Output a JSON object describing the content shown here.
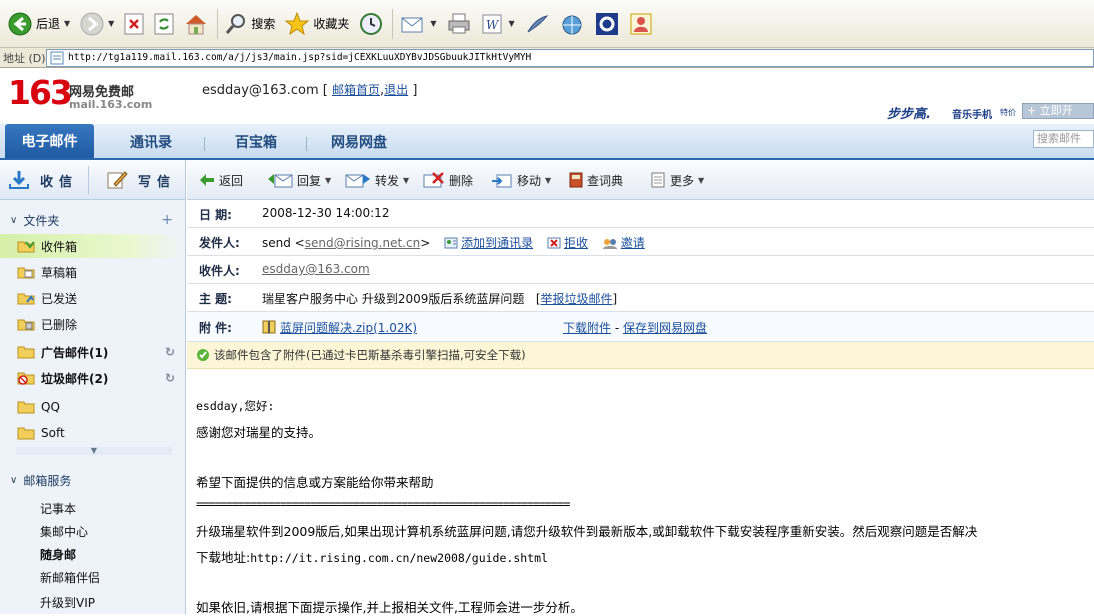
{
  "browser": {
    "toolbar": {
      "back_label": "后退",
      "search_label": "搜索",
      "favorites_label": "收藏夹"
    },
    "address": {
      "label": "地址 (D)",
      "url": "http://tg1a119.mail.163.com/a/j/js3/main.jsp?sid=jCEXKLuuXDYBvJDSGbuukJITkHtVyMYH"
    }
  },
  "header": {
    "logo_number": "163",
    "logo_title": "网易免费邮",
    "logo_domain": "mail.163.com",
    "user_email": "esdday@163.com",
    "bracket_open": "[",
    "home_link": "邮箱首页",
    "comma": ",",
    "logout_link": "退出",
    "bracket_close": "]",
    "ad_brand": "步步高.",
    "ad_sub": "音乐手机",
    "ad_sub2": "特价",
    "ad_open": "+ 立即开",
    "search_placeholder": "搜索邮件"
  },
  "nav": {
    "tabs": [
      "电子邮件",
      "通讯录",
      "百宝箱",
      "网易网盘"
    ]
  },
  "sidebar": {
    "receive_label": "收信",
    "write_label": "写信",
    "folders_head": "文件夹",
    "folders": [
      {
        "label": "收件箱"
      },
      {
        "label": "草稿箱"
      },
      {
        "label": "已发送"
      },
      {
        "label": "已删除"
      },
      {
        "label": "广告邮件(1)"
      },
      {
        "label": "垃圾邮件(2)"
      },
      {
        "label": "QQ"
      },
      {
        "label": "Soft"
      }
    ],
    "services_head": "邮箱服务",
    "services": [
      "记事本",
      "集邮中心",
      "随身邮",
      "新邮箱伴侣",
      "升级到VIP"
    ]
  },
  "mail_toolbar": {
    "back": "返回",
    "reply": "回复",
    "forward": "转发",
    "delete": "删除",
    "move": "移动",
    "dictionary": "查词典",
    "more": "更多"
  },
  "mail": {
    "date_label": "日  期:",
    "date": "2008-12-30 14:00:12",
    "from_label": "发件人:",
    "from_name": "send <",
    "from_email": "send@rising.net.cn",
    "from_close": ">",
    "add_contact": "添加到通讯录",
    "reject": "拒收",
    "invite": "邀请",
    "to_label": "收件人:",
    "to_email": "esdday@163.com",
    "subject_label": "主  题:",
    "subject": "瑞星客户服务中心 升级到2009版后系统蓝屏问题",
    "report_open": "[",
    "report_spam": "举报垃圾邮件",
    "report_close": "]",
    "attach_label": "附  件:",
    "attach_name": "蓝屏问题解决.zip(1.02K)",
    "download": "下载附件",
    "dash": "-",
    "save_netdisk": "保存到网易网盘",
    "notice": "该邮件包含了附件(已通过卡巴斯基杀毒引擎扫描,可安全下载)"
  },
  "body": {
    "greeting": "esdday,您好:",
    "line1": "感谢您对瑞星的支持。",
    "line2": "希望下面提供的信息或方案能给你带来帮助",
    "divider": "==============================================================",
    "line3": "升级瑞星软件到2009版后,如果出现计算机系统蓝屏问题,请您升级软件到最新版本,或卸载软件下载安装程序重新安装。然后观察问题是否解决",
    "line4_label": "下载地址:",
    "line4_url": "http://it.rising.com.cn/new2008/guide.shtml",
    "line5": "如果依旧,请根据下面提示操作,并上报相关文件,工程师会进一步分析。"
  },
  "colors": {
    "brand_red": "#d8000f",
    "nav_blue": "#1f5aa2",
    "link_blue": "#1b4f9c",
    "notice_bg": "#fcf6d6"
  }
}
